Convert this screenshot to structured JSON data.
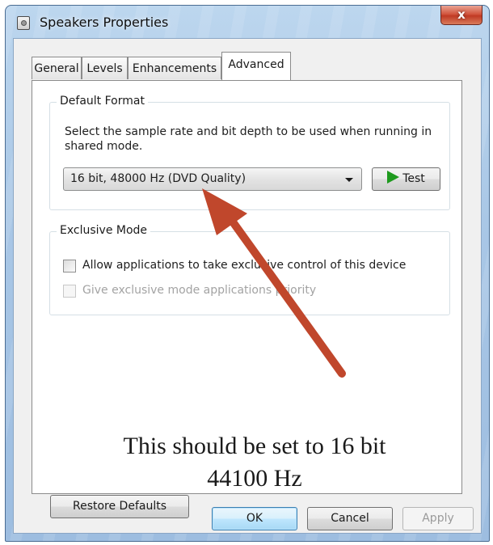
{
  "window": {
    "title": "Speakers Properties",
    "close_label": "x"
  },
  "tabs": [
    {
      "label": "General",
      "active": false
    },
    {
      "label": "Levels",
      "active": false
    },
    {
      "label": "Enhancements",
      "active": false
    },
    {
      "label": "Advanced",
      "active": true
    }
  ],
  "default_format": {
    "group_title": "Default Format",
    "description": "Select the sample rate and bit depth to be used when running in shared mode.",
    "selected_format": "16 bit, 48000 Hz (DVD Quality)",
    "test_label": "Test"
  },
  "exclusive_mode": {
    "group_title": "Exclusive Mode",
    "allow_label": "Allow applications to take exclusive control of this device",
    "allow_checked": false,
    "priority_label": "Give exclusive mode applications priority",
    "priority_checked": false,
    "priority_enabled": false
  },
  "annotation": {
    "text_line1": "This should be set to 16 bit",
    "text_line2": "44100 Hz",
    "arrow_color": "#c0472c"
  },
  "buttons": {
    "restore_defaults": "Restore Defaults",
    "ok": "OK",
    "cancel": "Cancel",
    "apply": "Apply"
  },
  "icons": {
    "window_icon": "speaker-properties-icon",
    "test_icon": "play-icon",
    "combo_icon": "chevron-down-icon"
  }
}
